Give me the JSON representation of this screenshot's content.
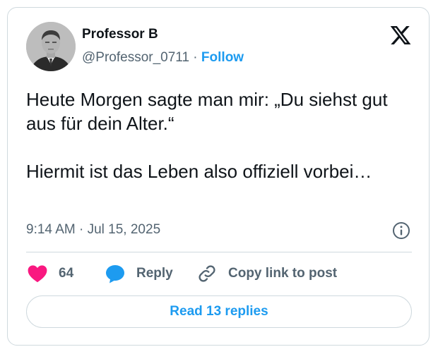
{
  "author": {
    "name": "Professor B",
    "handle": "@Professor_0711",
    "separator": " · ",
    "follow_label": "Follow"
  },
  "tweet": {
    "paragraphs": [
      "Heute Morgen sagte man mir: „Du siehst gut aus für dein Alter.“",
      "Hiermit ist das Leben also offiziell vorbei…"
    ],
    "time": "9:14 AM",
    "date_separator": " · ",
    "date": "Jul 15, 2025"
  },
  "actions": {
    "like_count": "64",
    "reply_label": "Reply",
    "copy_link_label": "Copy link to post"
  },
  "read_replies_label": "Read 13 replies",
  "icons": {
    "logo": "x-logo-icon",
    "info": "info-icon",
    "like": "heart-icon",
    "reply": "speech-bubble-icon",
    "copy_link": "link-icon"
  },
  "colors": {
    "accent": "#1d9bf0",
    "like": "#f91880",
    "text": "#0f1419",
    "secondary": "#536471",
    "border": "#cfd9de"
  }
}
